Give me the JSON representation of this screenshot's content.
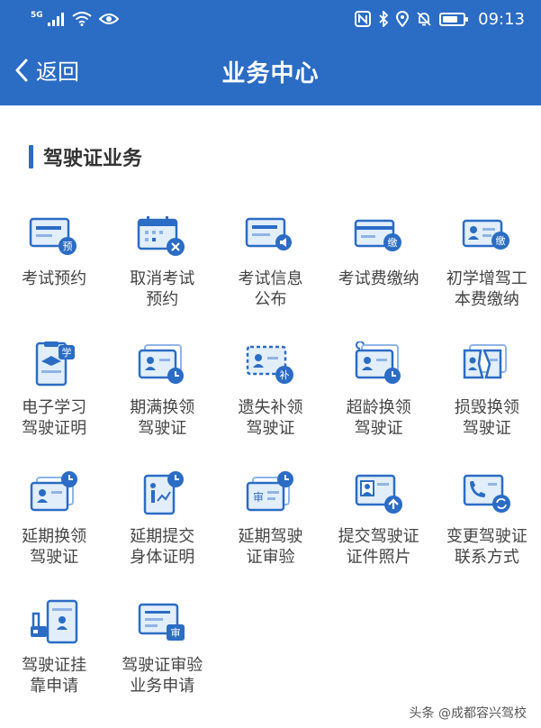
{
  "status_bar": {
    "network": "5G",
    "time": "09:13",
    "icons": [
      "signal-icon",
      "wifi-icon",
      "eye-icon",
      "nfc-icon",
      "bluetooth-icon",
      "location-icon",
      "mute-icon",
      "battery-icon"
    ]
  },
  "nav": {
    "back_label": "返回",
    "title": "业务中心"
  },
  "section": {
    "title": "驾驶证业务"
  },
  "services": [
    {
      "line1": "考试预约",
      "line2": "",
      "icon": "exam-booking-icon",
      "badge": "预"
    },
    {
      "line1": "取消考试",
      "line2": "预约",
      "icon": "cancel-calendar-icon",
      "badge": "×"
    },
    {
      "line1": "考试信息",
      "line2": "公布",
      "icon": "exam-info-icon",
      "badge": ""
    },
    {
      "line1": "考试费缴纳",
      "line2": "",
      "icon": "exam-fee-icon",
      "badge": "缴"
    },
    {
      "line1": "初学增驾工",
      "line2": "本费缴纳",
      "icon": "cost-payment-icon",
      "badge": "缴"
    },
    {
      "line1": "电子学习",
      "line2": "驾驶证明",
      "icon": "study-certificate-icon",
      "badge": "学"
    },
    {
      "line1": "期满换领",
      "line2": "驾驶证",
      "icon": "expiry-renewal-icon",
      "badge": ""
    },
    {
      "line1": "遗失补领",
      "line2": "驾驶证",
      "icon": "lost-replacement-icon",
      "badge": "补"
    },
    {
      "line1": "超龄换领",
      "line2": "驾驶证",
      "icon": "overage-renewal-icon",
      "badge": ""
    },
    {
      "line1": "损毁换领",
      "line2": "驾驶证",
      "icon": "damaged-renewal-icon",
      "badge": ""
    },
    {
      "line1": "延期换领",
      "line2": "驾驶证",
      "icon": "deferred-renewal-icon",
      "badge": ""
    },
    {
      "line1": "延期提交",
      "line2": "身体证明",
      "icon": "health-certificate-icon",
      "badge": ""
    },
    {
      "line1": "延期驾驶",
      "line2": "证审验",
      "icon": "deferred-review-icon",
      "badge": "审"
    },
    {
      "line1": "提交驾驶证",
      "line2": "证件照片",
      "icon": "photo-upload-icon",
      "badge": ""
    },
    {
      "line1": "变更驾驶证",
      "line2": "联系方式",
      "icon": "contact-change-icon",
      "badge": ""
    },
    {
      "line1": "驾驶证挂",
      "line2": "靠申请",
      "icon": "affiliation-icon",
      "badge": ""
    },
    {
      "line1": "驾驶证审验",
      "line2": "业务申请",
      "icon": "review-application-icon",
      "badge": "审"
    }
  ],
  "watermark": "头条 @成都容兴驾校",
  "colors": {
    "primary": "#2b6cc4",
    "light": "#8fb4e6",
    "icon_fill": "#e3eefb"
  }
}
